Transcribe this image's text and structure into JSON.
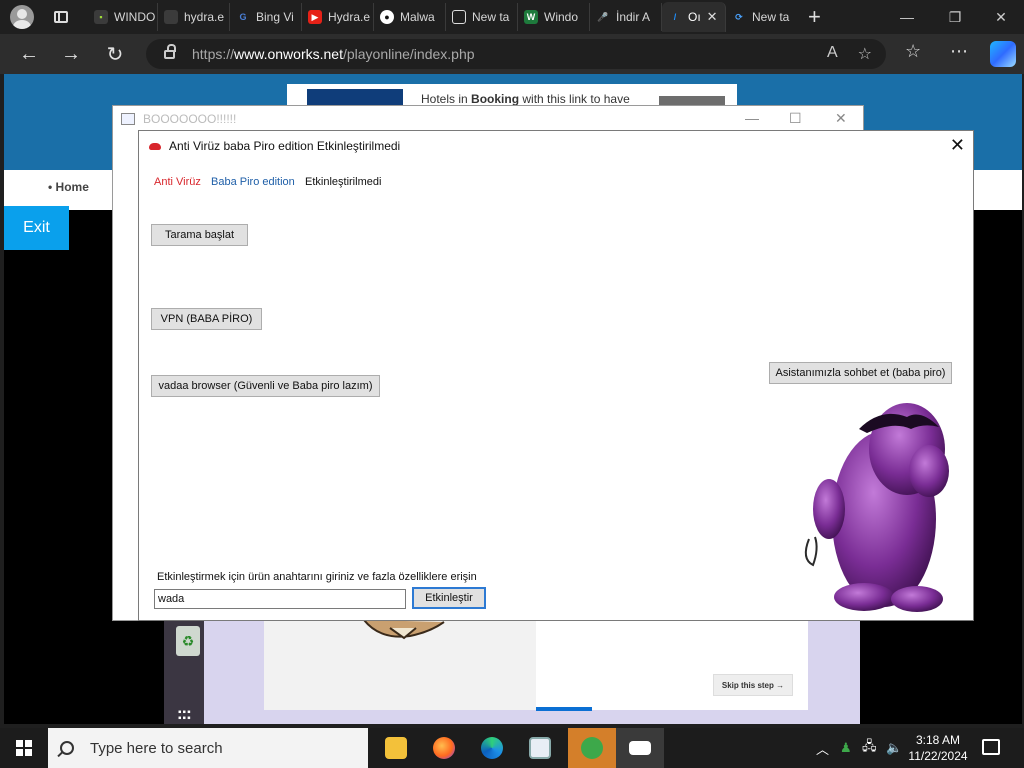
{
  "browser": {
    "tabs": [
      {
        "label": "WINDO",
        "color": "#3b3b3b"
      },
      {
        "label": "hydra.e",
        "color": "#3b3b3b"
      },
      {
        "label": "Bing Vi",
        "color": "#3b3b3b"
      },
      {
        "label": "Hydra.e",
        "color": "#e62117"
      },
      {
        "label": "Malwa",
        "color": "#ffffff"
      },
      {
        "label": "New ta",
        "color": "#ffffff"
      },
      {
        "label": "Windo",
        "color": "#1e7a3c"
      },
      {
        "label": "İndir A",
        "color": "#c0392b"
      },
      {
        "label": "Oı",
        "color": "#1e90ff"
      },
      {
        "label": "New ta",
        "color": "#ffffff"
      }
    ],
    "new_tab_icon": "plus-icon",
    "url_host": "https://www.onworks.net",
    "url_path": "/playonline/index.php",
    "read_aloud_icon": "A",
    "favorite_icon": "☆"
  },
  "page": {
    "home_link": "• Home",
    "exit_button": "Exit",
    "ad_text_pre": "Hotels in ",
    "ad_text_bold": "Booking",
    "ad_text_post": " with this link to have",
    "skip_button": "Skip this step →"
  },
  "outer_window": {
    "title": "BOOOOOOO!!!!!!"
  },
  "dialog": {
    "title": "Anti Virüz baba Piro edition Etkinleştirilmedi",
    "brand_red": "Anti Virüz",
    "brand_blue": "Baba Piro edition",
    "brand_status": "Etkinleştirilmedi",
    "scan_button": "Tarama başlat",
    "vpn_button": "VPN (BABA PİRO)",
    "browser_button": "vadaa browser (Güvenli ve Baba piro lazım)",
    "assistant_button": "Asistanımızla sohbet et (baba piro)",
    "activation_prompt": "Etkinleştirmek için ürün anahtarını giriniz ve fazla özelliklere erişin",
    "key_value": "wada",
    "activate_button": "Etkinleştir",
    "colors": {
      "red": "#d8262c",
      "blue": "#1f5fa8"
    }
  },
  "taskbar": {
    "search_placeholder": "Type here to search",
    "time": "3:18 AM",
    "date": "11/22/2024"
  }
}
